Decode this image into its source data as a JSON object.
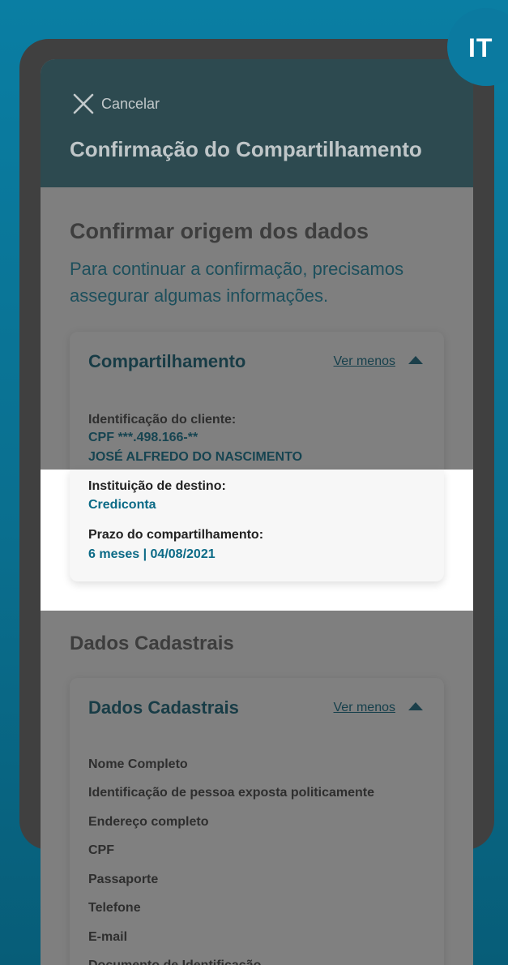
{
  "badge": "IT",
  "header": {
    "cancel_label": "Cancelar",
    "title": "Confirmação do Compartilhamento"
  },
  "confirm": {
    "title": "Confirmar origem dos dados",
    "description": "Para continuar a confirmação, precisamos assegurar algumas informações."
  },
  "sharing_card": {
    "title": "Compartilhamento",
    "toggle_label": "Ver menos",
    "client_label": "Identificação do cliente:",
    "client_cpf": "CPF ***.498.166-**",
    "client_name": "JOSÉ ALFREDO DO NASCIMENTO",
    "destination_label": "Instituição de destino:",
    "destination_value": "Crediconta",
    "period_label": "Prazo do compartilhamento:",
    "period_value": "6 meses | 04/08/2021"
  },
  "registration": {
    "section_title": "Dados Cadastrais",
    "card_title": "Dados Cadastrais",
    "toggle_label": "Ver menos",
    "items": [
      "Nome Completo",
      "Identificação de pessoa exposta politicamente",
      "Endereço completo",
      "CPF",
      "Passaporte",
      "Telefone",
      "E-mail",
      "Documento de Identificação"
    ]
  },
  "colors": {
    "header_bg": "#2d4a50",
    "accent": "#0b6a86",
    "background": "#0a7ea3"
  },
  "icons": {
    "close": "close-icon",
    "toggle": "chevron-up-icon"
  }
}
